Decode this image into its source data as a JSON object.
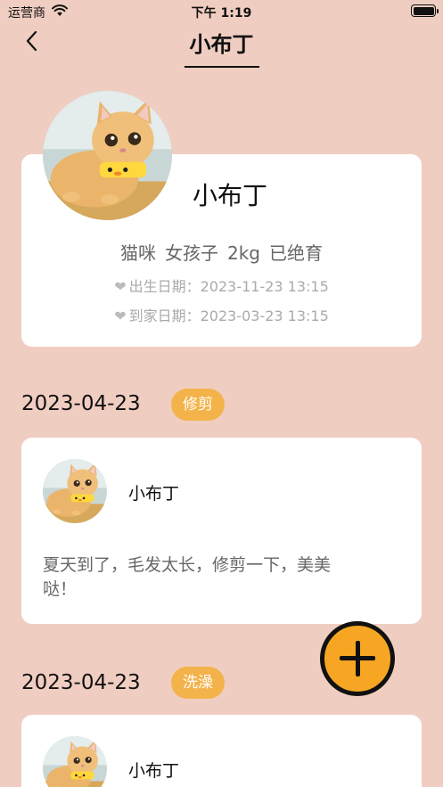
{
  "status_bar": {
    "carrier": "运营商",
    "time": "下午 1:19"
  },
  "nav": {
    "title": "小布丁"
  },
  "profile": {
    "name": "小布丁",
    "tags": [
      "猫咪",
      "女孩子",
      "2kg",
      "已绝育"
    ],
    "birth_label": "出生日期：",
    "birth_value": "2023-11-23 13:15",
    "home_label": "到家日期：",
    "home_value": "2023-03-23 13:15"
  },
  "records": [
    {
      "date": "2023-04-23",
      "tag": "修剪",
      "name": "小布丁",
      "text": "夏天到了，毛发太长，修剪一下，美美哒！"
    },
    {
      "date": "2023-04-23",
      "tag": "洗澡",
      "name": "小布丁",
      "text": ""
    }
  ],
  "icons": {
    "back": "chevron-left-icon",
    "heart": "heart-icon",
    "add": "plus-icon",
    "wifi": "wifi-icon",
    "battery": "battery-icon"
  },
  "colors": {
    "background": "#f0cdc1",
    "accent": "#f3b34a",
    "fab": "#f6a623"
  }
}
